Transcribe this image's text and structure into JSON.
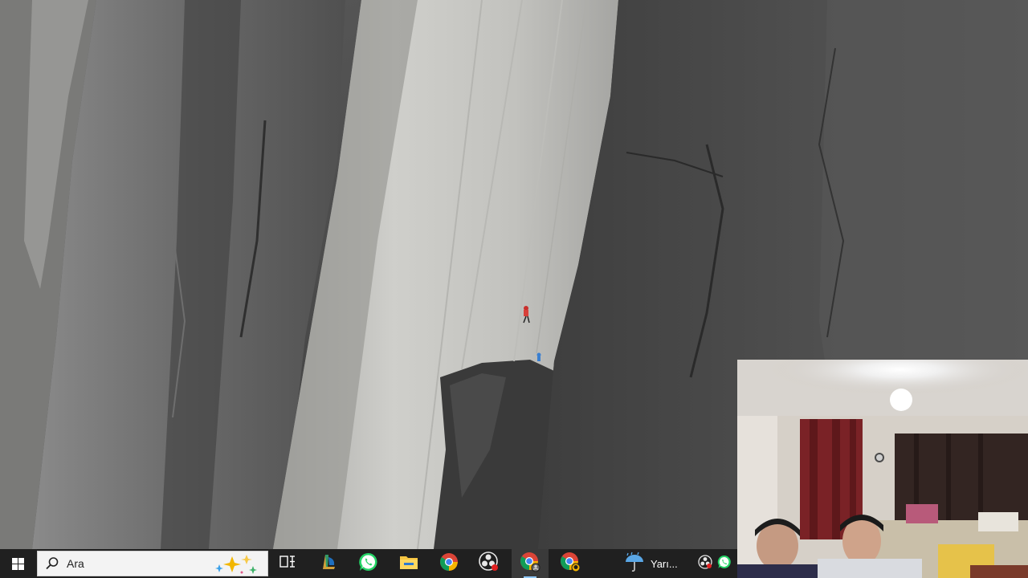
{
  "taskbar": {
    "search": {
      "placeholder": "Ara"
    },
    "apps": [
      {
        "icon": "task-view-icon"
      },
      {
        "icon": "edge-app-icon"
      },
      {
        "icon": "whatsapp-icon"
      },
      {
        "icon": "file-explorer-icon"
      },
      {
        "icon": "chrome-icon"
      },
      {
        "icon": "obs-icon"
      },
      {
        "icon": "chrome-profile-icon",
        "active": true
      },
      {
        "icon": "chrome-icon"
      }
    ],
    "weather": {
      "text": "Yarı..."
    },
    "tray": [
      {
        "icon": "obs-tray-icon"
      },
      {
        "icon": "whatsapp-tray-icon"
      }
    ]
  },
  "colors": {
    "taskbar_bg": "#202020",
    "search_bg": "#f3f3f3",
    "whatsapp": "#25d366",
    "chrome_red": "#db4437",
    "chrome_yellow": "#f4b400",
    "chrome_green": "#0f9d58",
    "chrome_blue": "#4285f4"
  }
}
